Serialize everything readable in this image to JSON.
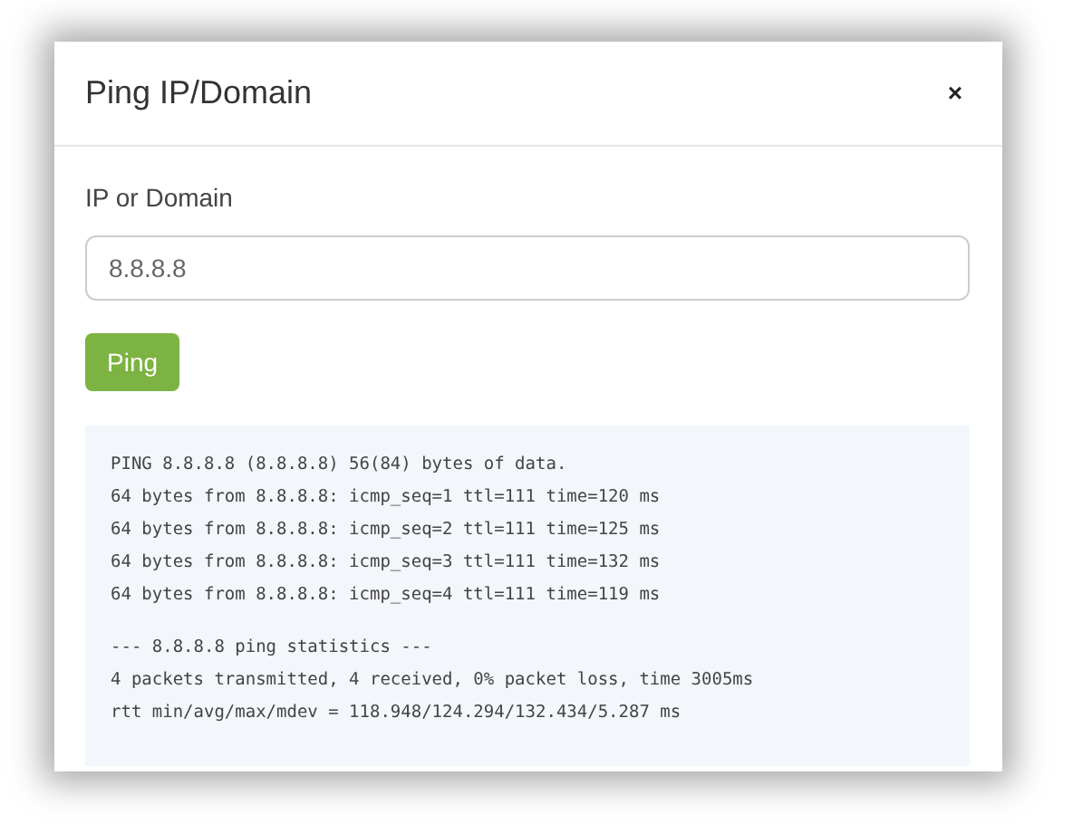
{
  "dialog": {
    "title": "Ping IP/Domain",
    "close": "×"
  },
  "field": {
    "label": "IP or Domain",
    "value": "8.8.8.8"
  },
  "button": "Ping",
  "output": [
    [
      "PING 8.8.8.8 (8.8.8.8) 56(84) bytes of data.",
      "64 bytes from 8.8.8.8: icmp_seq=1 ttl=111 time=120 ms",
      "64 bytes from 8.8.8.8: icmp_seq=2 ttl=111 time=125 ms",
      "64 bytes from 8.8.8.8: icmp_seq=3 ttl=111 time=132 ms",
      "64 bytes from 8.8.8.8: icmp_seq=4 ttl=111 time=119 ms"
    ],
    [
      "--- 8.8.8.8 ping statistics ---",
      "4 packets transmitted, 4 received, 0% packet loss, time 3005ms",
      "rtt min/avg/max/mdev = 118.948/124.294/132.434/5.287 ms"
    ]
  ]
}
